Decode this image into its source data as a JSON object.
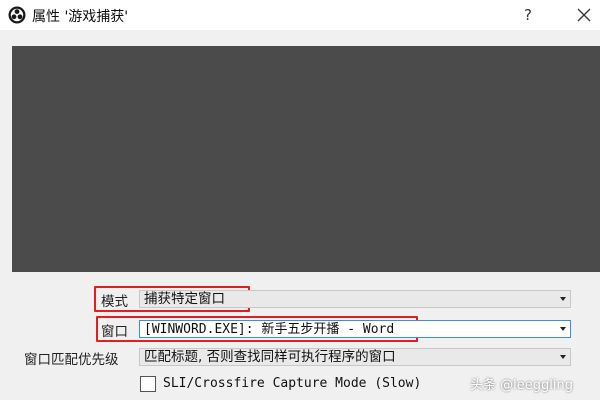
{
  "window": {
    "title": "属性 '游戏捕获'",
    "help_glyph": "?",
    "app_icon": "obs-logo-icon",
    "close_icon": "close-icon"
  },
  "properties": {
    "mode": {
      "label": "模式",
      "value": "捕获特定窗口"
    },
    "window": {
      "label": "窗口",
      "value": "[WINWORD.EXE]: 新手五步开播 - Word"
    },
    "match_priority": {
      "label": "窗口匹配优先级",
      "value": "匹配标题, 否则查找同样可执行程序的窗口"
    },
    "sli_crossfire": {
      "label": "SLI/Crossfire Capture Mode (Slow)",
      "checked": false
    }
  },
  "watermark": "头条 @leeggling",
  "colors": {
    "preview_bg": "#4b4b4b",
    "highlight": "#e02020",
    "focus_border": "#3b8de0"
  }
}
